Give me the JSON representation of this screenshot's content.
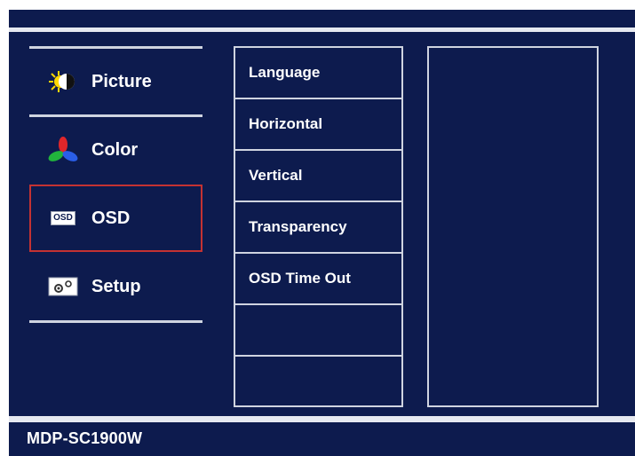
{
  "menu": {
    "categories": [
      {
        "label": "Picture",
        "icon": "picture-icon"
      },
      {
        "label": "Color",
        "icon": "color-icon"
      },
      {
        "label": "OSD",
        "icon": "osd-icon"
      },
      {
        "label": "Setup",
        "icon": "setup-icon"
      }
    ],
    "selected": "OSD"
  },
  "submenu": {
    "items": [
      "Language",
      "Horizontal",
      "Vertical",
      "Transparency",
      "OSD Time Out",
      "",
      ""
    ]
  },
  "icons": {
    "osd_badge": "OSD"
  },
  "footer": {
    "model": "MDP-SC1900W"
  },
  "colors": {
    "background": "#0d1b4e",
    "rule": "#e6e9f0",
    "selected_border": "#c43232",
    "text": "#ffffff"
  }
}
